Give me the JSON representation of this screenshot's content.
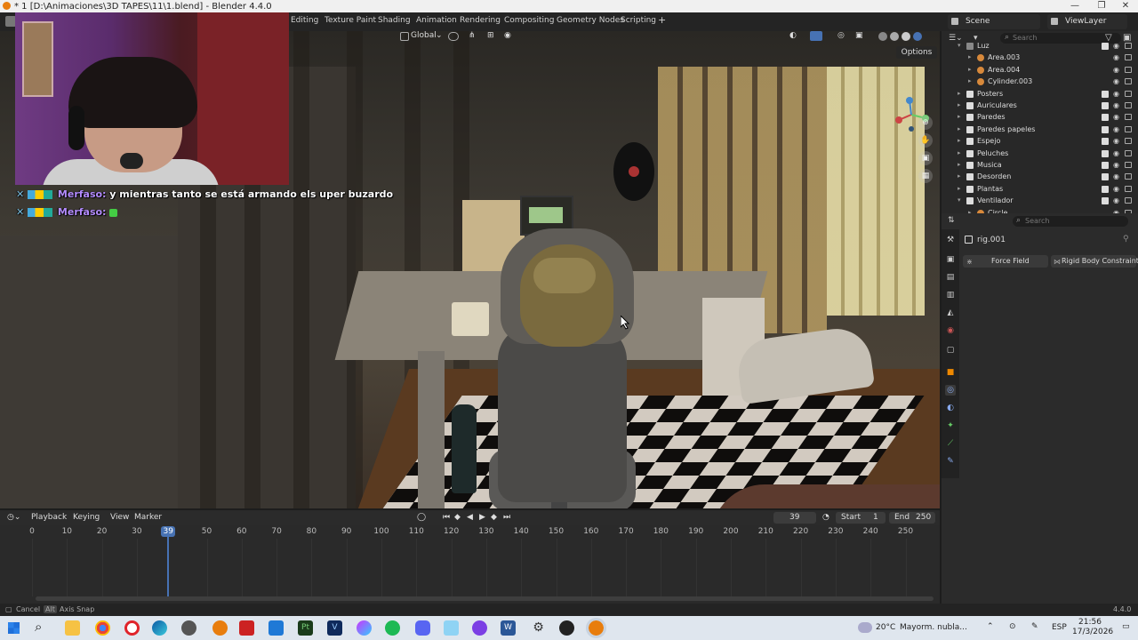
{
  "window": {
    "title": "* 1 [D:\\Animaciones\\3D TAPES\\11\\1.blend] - Blender 4.4.0"
  },
  "workspaces": [
    {
      "label": "Editing"
    },
    {
      "label": "Texture Paint"
    },
    {
      "label": "Shading"
    },
    {
      "label": "Animation"
    },
    {
      "label": "Rendering"
    },
    {
      "label": "Compositing"
    },
    {
      "label": "Geometry Nodes"
    },
    {
      "label": "Scripting"
    }
  ],
  "add_workspace_label": "+",
  "scene": {
    "name": "Scene"
  },
  "view_layer": {
    "name": "ViewLayer"
  },
  "viewport": {
    "orientation": "Global",
    "options_label": "Options"
  },
  "chat": [
    {
      "user": "Merfaso:",
      "message": "y mientras tanto se está armando els uper buzardo"
    },
    {
      "user": "Merfaso:",
      "message": ""
    }
  ],
  "timeline": {
    "menus": [
      "Playback",
      "Keying",
      "View",
      "Marker"
    ],
    "current_frame": "39",
    "start_label": "Start",
    "start_value": "1",
    "end_label": "End",
    "end_value": "250",
    "ruler": [
      0,
      10,
      20,
      30,
      39,
      50,
      60,
      70,
      80,
      90,
      100,
      110,
      120,
      130,
      140,
      150,
      160,
      170,
      180,
      190,
      200,
      210,
      220,
      230,
      240,
      250
    ],
    "playhead_frame": 39
  },
  "status": {
    "cancel": "Cancel",
    "alt_key": "Alt",
    "axis_snap": "Axis Snap",
    "version": "4.4.0"
  },
  "outliner": {
    "search_placeholder": "Search",
    "rows": [
      {
        "label": "Luz",
        "indent": 0,
        "expanded": true,
        "icon_color": "#888888"
      },
      {
        "label": "Area.003",
        "indent": 1,
        "expanded": false,
        "icon_color": "#d8893b"
      },
      {
        "label": "Area.004",
        "indent": 1,
        "expanded": false,
        "icon_color": "#d8893b"
      },
      {
        "label": "Cylinder.003",
        "indent": 1,
        "expanded": false,
        "icon_color": "#d8893b"
      },
      {
        "label": "Posters",
        "indent": 0,
        "expanded": false,
        "icon_color": "#dddddd"
      },
      {
        "label": "Auriculares",
        "indent": 0,
        "expanded": false,
        "icon_color": "#dddddd"
      },
      {
        "label": "Paredes",
        "indent": 0,
        "expanded": false,
        "icon_color": "#dddddd"
      },
      {
        "label": "Paredes papeles",
        "indent": 0,
        "expanded": false,
        "icon_color": "#dddddd"
      },
      {
        "label": "Espejo",
        "indent": 0,
        "expanded": false,
        "icon_color": "#dddddd"
      },
      {
        "label": "Peluches",
        "indent": 0,
        "expanded": false,
        "icon_color": "#dddddd"
      },
      {
        "label": "Musica",
        "indent": 0,
        "expanded": false,
        "icon_color": "#dddddd"
      },
      {
        "label": "Desorden",
        "indent": 0,
        "expanded": false,
        "icon_color": "#dddddd"
      },
      {
        "label": "Plantas",
        "indent": 0,
        "expanded": false,
        "icon_color": "#dddddd"
      },
      {
        "label": "Ventilador",
        "indent": 0,
        "expanded": true,
        "icon_color": "#dddddd"
      },
      {
        "label": "Circle",
        "indent": 1,
        "expanded": false,
        "icon_color": "#d8893b"
      }
    ]
  },
  "properties": {
    "search_placeholder": "Search",
    "object_name": "rig.001",
    "buttons": [
      {
        "label": "Force Field"
      },
      {
        "label": "Rigid Body Constraint"
      }
    ]
  },
  "taskbar": {
    "weather_temp": "20°C",
    "weather_text": "Mayorm. nubla...",
    "language": "ESP",
    "time": "21:56",
    "date": "17/3/2026"
  },
  "colors": {
    "accent": "#4772b3",
    "selection": "#334d80",
    "chat_user": "#b48cff"
  }
}
